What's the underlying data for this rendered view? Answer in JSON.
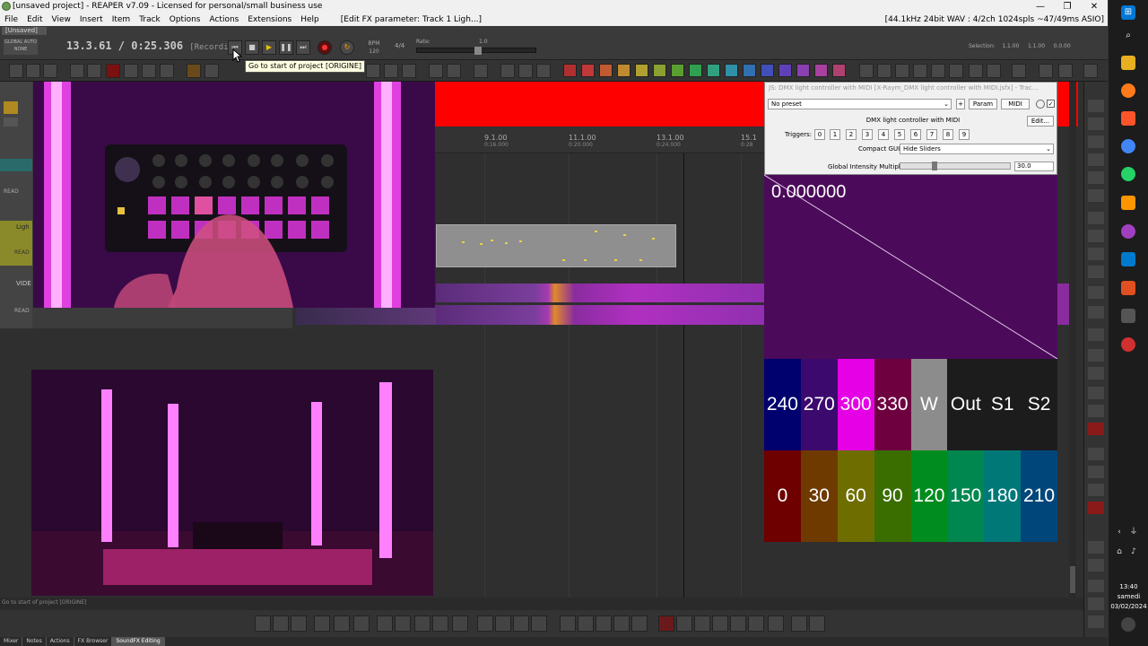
{
  "titlebar": {
    "title": "[unsaved project] - REAPER v7.09 - Licensed for personal/small business use"
  },
  "window_controls": {
    "minimize": "—",
    "restore": "❐",
    "close": "✕"
  },
  "menu": {
    "items": [
      "File",
      "Edit",
      "View",
      "Insert",
      "Item",
      "Track",
      "Options",
      "Actions",
      "Extensions",
      "Help"
    ],
    "fx_param": "[Edit FX parameter: Track 1 Ligh...]",
    "audio_info": "[44.1kHz 24bit WAV : 4/2ch 1024spls ~47/49ms ASIO]"
  },
  "transport": {
    "project_tab": "[Unsaved]",
    "global_auto": "GLOBAL AUTO",
    "global_auto_sub": "NONE",
    "time": "13.3.61 / 0:25.306",
    "status": "[Recording]",
    "bpm_label": "BPM",
    "bpm_value": "120",
    "timesig": "4/4",
    "rate_label": "Rate:",
    "rate_value": "1.0",
    "selection_label": "Selection:",
    "selection_start": "1.1.00",
    "selection_end": "1.1.00",
    "selection_len": "0.0.00"
  },
  "tooltip": {
    "text": "Go to start of project [ORIGINE]"
  },
  "ruler": {
    "marks": [
      {
        "bar": "9.1.00",
        "time": "0:16.000"
      },
      {
        "bar": "11.1.00",
        "time": "0:20.000"
      },
      {
        "bar": "13.1.00",
        "time": "0:24.000"
      },
      {
        "bar": "15.1",
        "time": "0:28"
      }
    ]
  },
  "tracks": {
    "labels": [
      "Ligh",
      "VIDE"
    ],
    "read_label": "READ"
  },
  "fx_window": {
    "title": "JS: DMX light controller with MIDI [X-Raym_DMX light controller with MIDI.jsfx] - Trac...",
    "preset": "No preset",
    "plus": "+",
    "param_btn": "Param",
    "midi_btn": "MIDI",
    "plugin_name": "DMX light controller with MIDI",
    "edit_btn": "Edit...",
    "triggers_label": "Triggers:",
    "triggers": [
      "0",
      "1",
      "2",
      "3",
      "4",
      "5",
      "6",
      "7",
      "8",
      "9"
    ],
    "compact_gui_label": "Compact GUI",
    "compact_gui_value": "Hide Sliders",
    "intensity_label": "Global Intensity Multiplier",
    "intensity_value": "30.0",
    "intensity_level": 0.3,
    "display_value": "0.000000"
  },
  "palette": {
    "row1": [
      {
        "label": "240",
        "color": "#00006e"
      },
      {
        "label": "270",
        "color": "#3c0a6e"
      },
      {
        "label": "300",
        "color": "#e600e6"
      },
      {
        "label": "330",
        "color": "#6e0040"
      },
      {
        "label": "W",
        "color": "#8c8c8c"
      },
      {
        "label": "Out",
        "color": "#1c1c1c"
      },
      {
        "label": "S1",
        "color": "#1c1c1c"
      },
      {
        "label": "S2",
        "color": "#1c1c1c"
      }
    ],
    "row2": [
      {
        "label": "0",
        "color": "#6e0000"
      },
      {
        "label": "30",
        "color": "#6e3a00"
      },
      {
        "label": "60",
        "color": "#6e6e00"
      },
      {
        "label": "90",
        "color": "#3a6e00"
      },
      {
        "label": "120",
        "color": "#008c1e"
      },
      {
        "label": "150",
        "color": "#00874f"
      },
      {
        "label": "180",
        "color": "#007878"
      },
      {
        "label": "210",
        "color": "#00467a"
      }
    ]
  },
  "status_bar": {
    "text": "Go to start of project [ORIGINE]"
  },
  "dock_tabs": [
    "Mixer",
    "Notes",
    "Actions",
    "FX Browser",
    "SoundFX Editing"
  ],
  "taskbar": {
    "time": "13:40",
    "day": "samedi",
    "date": "03/02/2024"
  },
  "colors": {
    "accent_red": "#ff0000",
    "purple": "#4c0a5a",
    "magenta": "#e600e6"
  }
}
